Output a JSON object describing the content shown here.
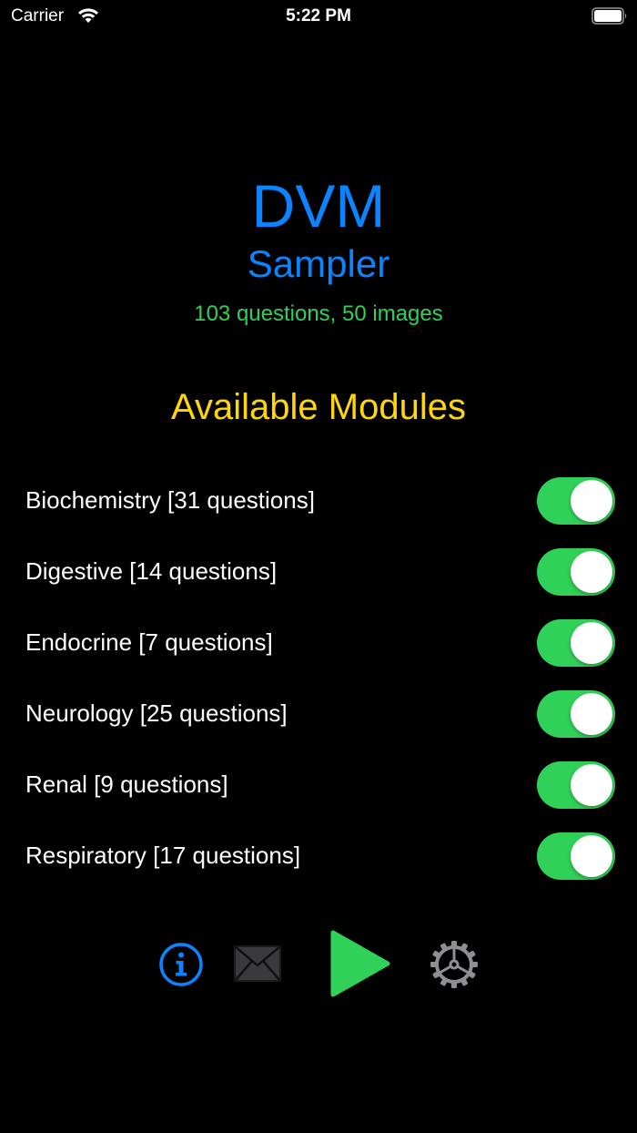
{
  "status_bar": {
    "carrier": "Carrier",
    "time": "5:22 PM"
  },
  "header": {
    "title": "DVM",
    "subtitle": "Sampler",
    "stats": "103 questions, 50 images"
  },
  "modules_heading": "Available Modules",
  "modules": [
    {
      "label": "Biochemistry [31 questions]",
      "enabled": true
    },
    {
      "label": "Digestive [14 questions]",
      "enabled": true
    },
    {
      "label": "Endocrine [7 questions]",
      "enabled": true
    },
    {
      "label": "Neurology [25 questions]",
      "enabled": true
    },
    {
      "label": "Renal [9 questions]",
      "enabled": true
    },
    {
      "label": "Respiratory [17 questions]",
      "enabled": true
    }
  ],
  "toolbar": {
    "icons": [
      "info-icon",
      "mail-icon",
      "play-icon",
      "gear-icon"
    ]
  },
  "colors": {
    "background": "#000000",
    "title_blue": "#0a84ff",
    "stats_green": "#30d158",
    "heading_yellow": "#ffd60a",
    "toggle_on": "#30d158",
    "icon_gray": "#8e8e93",
    "mail_gray": "#3a3a3c"
  }
}
